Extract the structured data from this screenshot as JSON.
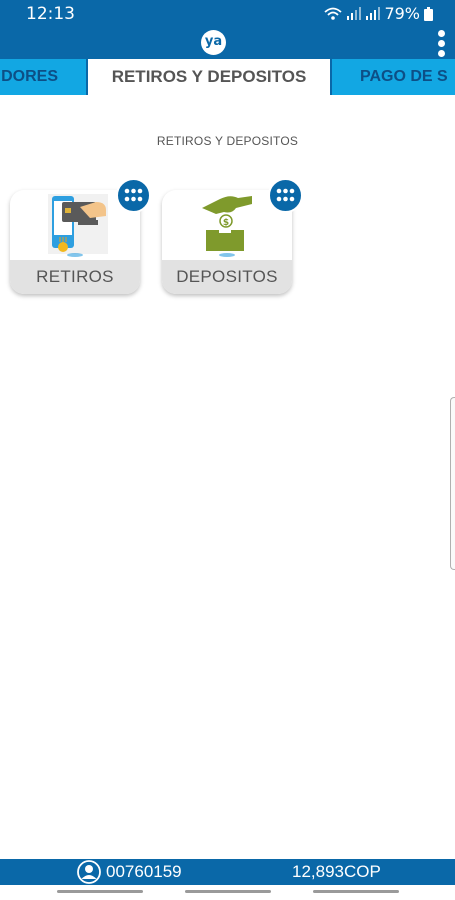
{
  "status_bar": {
    "time": "12:13",
    "battery": "79%"
  },
  "app": {
    "logo_text": "ya",
    "colors": {
      "primary": "#0a68a8",
      "tab_inactive": "#12a7e3",
      "card_label_bg": "#e2e2e2",
      "deposit_green": "#7f9a2c"
    }
  },
  "tabs": [
    {
      "label": "DORES",
      "active": false
    },
    {
      "label": "RETIROS Y DEPOSITOS",
      "active": true
    },
    {
      "label": "PAGO DE S",
      "active": false
    }
  ],
  "section_title": "RETIROS Y DEPOSITOS",
  "cards": [
    {
      "label": "RETIROS",
      "icon": "phone-card-withdraw-icon"
    },
    {
      "label": "DEPOSITOS",
      "icon": "hand-coin-deposit-icon"
    }
  ],
  "footer": {
    "account_number": "00760159",
    "balance": "12,893COP"
  }
}
